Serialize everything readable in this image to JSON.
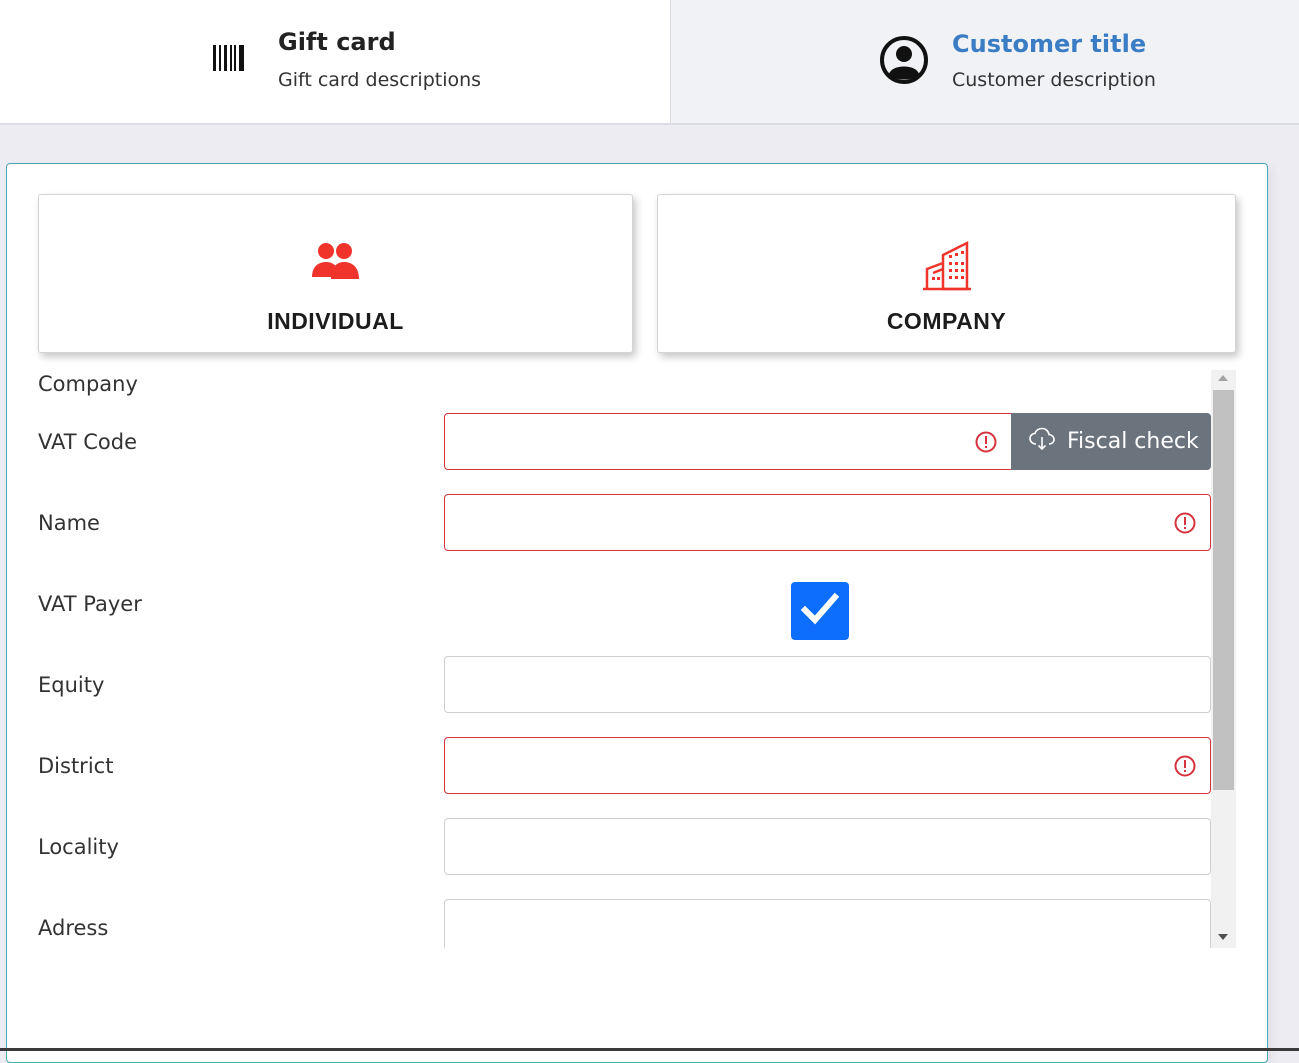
{
  "tabs": [
    {
      "title": "Gift card",
      "description": "Gift card descriptions",
      "icon": "barcode-icon"
    },
    {
      "title": "Customer title",
      "description": "Customer description",
      "icon": "user-circle-icon"
    }
  ],
  "customer_types": [
    {
      "label": "INDIVIDUAL",
      "icon": "users-icon"
    },
    {
      "label": "COMPANY",
      "icon": "building-icon"
    }
  ],
  "form": {
    "section_title": "Company",
    "fields": [
      {
        "label": "VAT Code",
        "value": "",
        "invalid": true
      },
      {
        "label": "Name",
        "value": "",
        "invalid": true
      },
      {
        "label": "VAT Payer",
        "checked": true
      },
      {
        "label": "Equity",
        "value": ""
      },
      {
        "label": "District",
        "value": "",
        "invalid": true
      },
      {
        "label": "Locality",
        "value": ""
      },
      {
        "label": "Adress",
        "value": ""
      }
    ],
    "fiscal_check_label": "Fiscal check"
  },
  "colors": {
    "accent_red": "#f0342c",
    "link_blue": "#3a7dc4",
    "error_red": "#d6333f",
    "checkbox_blue": "#0d6efd",
    "button_gray": "#6b737c",
    "panel_border": "#46a9b4"
  }
}
